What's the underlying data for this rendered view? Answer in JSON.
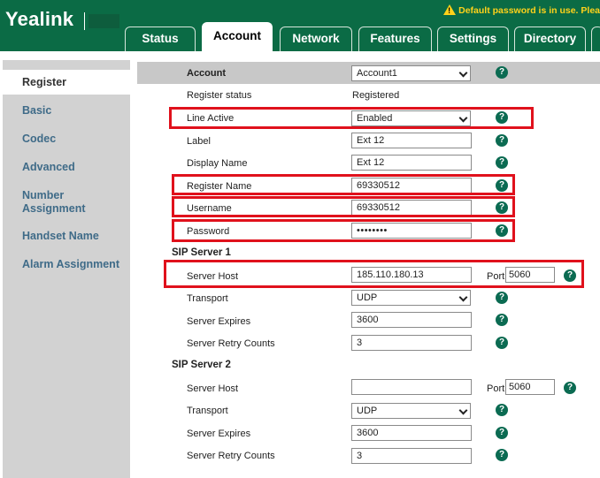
{
  "header": {
    "logo": "Yealink",
    "warning": "Default password is in use. Plea",
    "tabs": [
      {
        "label": "Status",
        "active": false
      },
      {
        "label": "Account",
        "active": true
      },
      {
        "label": "Network",
        "active": false
      },
      {
        "label": "Features",
        "active": false
      },
      {
        "label": "Settings",
        "active": false
      },
      {
        "label": "Directory",
        "active": false
      }
    ]
  },
  "sidebar": {
    "items": [
      {
        "label": "Register",
        "active": true
      },
      {
        "label": "Basic"
      },
      {
        "label": "Codec"
      },
      {
        "label": "Advanced"
      },
      {
        "label": "Number Assignment"
      },
      {
        "label": "Handset Name"
      },
      {
        "label": "Alarm Assignment"
      }
    ]
  },
  "form": {
    "account": {
      "label": "Account",
      "value": "Account1"
    },
    "register_status": {
      "label": "Register status",
      "value": "Registered"
    },
    "line_active": {
      "label": "Line Active",
      "value": "Enabled"
    },
    "label": {
      "label": "Label",
      "value": "Ext 12"
    },
    "display_name": {
      "label": "Display Name",
      "value": "Ext 12"
    },
    "register_name": {
      "label": "Register Name",
      "value": "69330512"
    },
    "username": {
      "label": "Username",
      "value": "69330512"
    },
    "password": {
      "label": "Password",
      "value": "••••••••"
    },
    "help_glyph": "?",
    "sip1": {
      "title": "SIP Server 1",
      "server_host": {
        "label": "Server Host",
        "value": "185.110.180.13"
      },
      "port_label": "Port",
      "port": "5060",
      "transport": {
        "label": "Transport",
        "value": "UDP"
      },
      "server_expires": {
        "label": "Server Expires",
        "value": "3600"
      },
      "retry_counts": {
        "label": "Server Retry Counts",
        "value": "3"
      }
    },
    "sip2": {
      "title": "SIP Server 2",
      "server_host": {
        "label": "Server Host",
        "value": ""
      },
      "port_label": "Port",
      "port": "5060",
      "transport": {
        "label": "Transport",
        "value": "UDP"
      },
      "server_expires": {
        "label": "Server Expires",
        "value": "3600"
      },
      "retry_counts": {
        "label": "Server Retry Counts",
        "value": "3"
      }
    }
  },
  "colors": {
    "brand_green": "#0b6b45",
    "highlight_red": "#e0111c",
    "sidebar_gray": "#d2d2d2",
    "link_blue": "#3f6b88",
    "warning_yellow": "#ffd21a"
  }
}
